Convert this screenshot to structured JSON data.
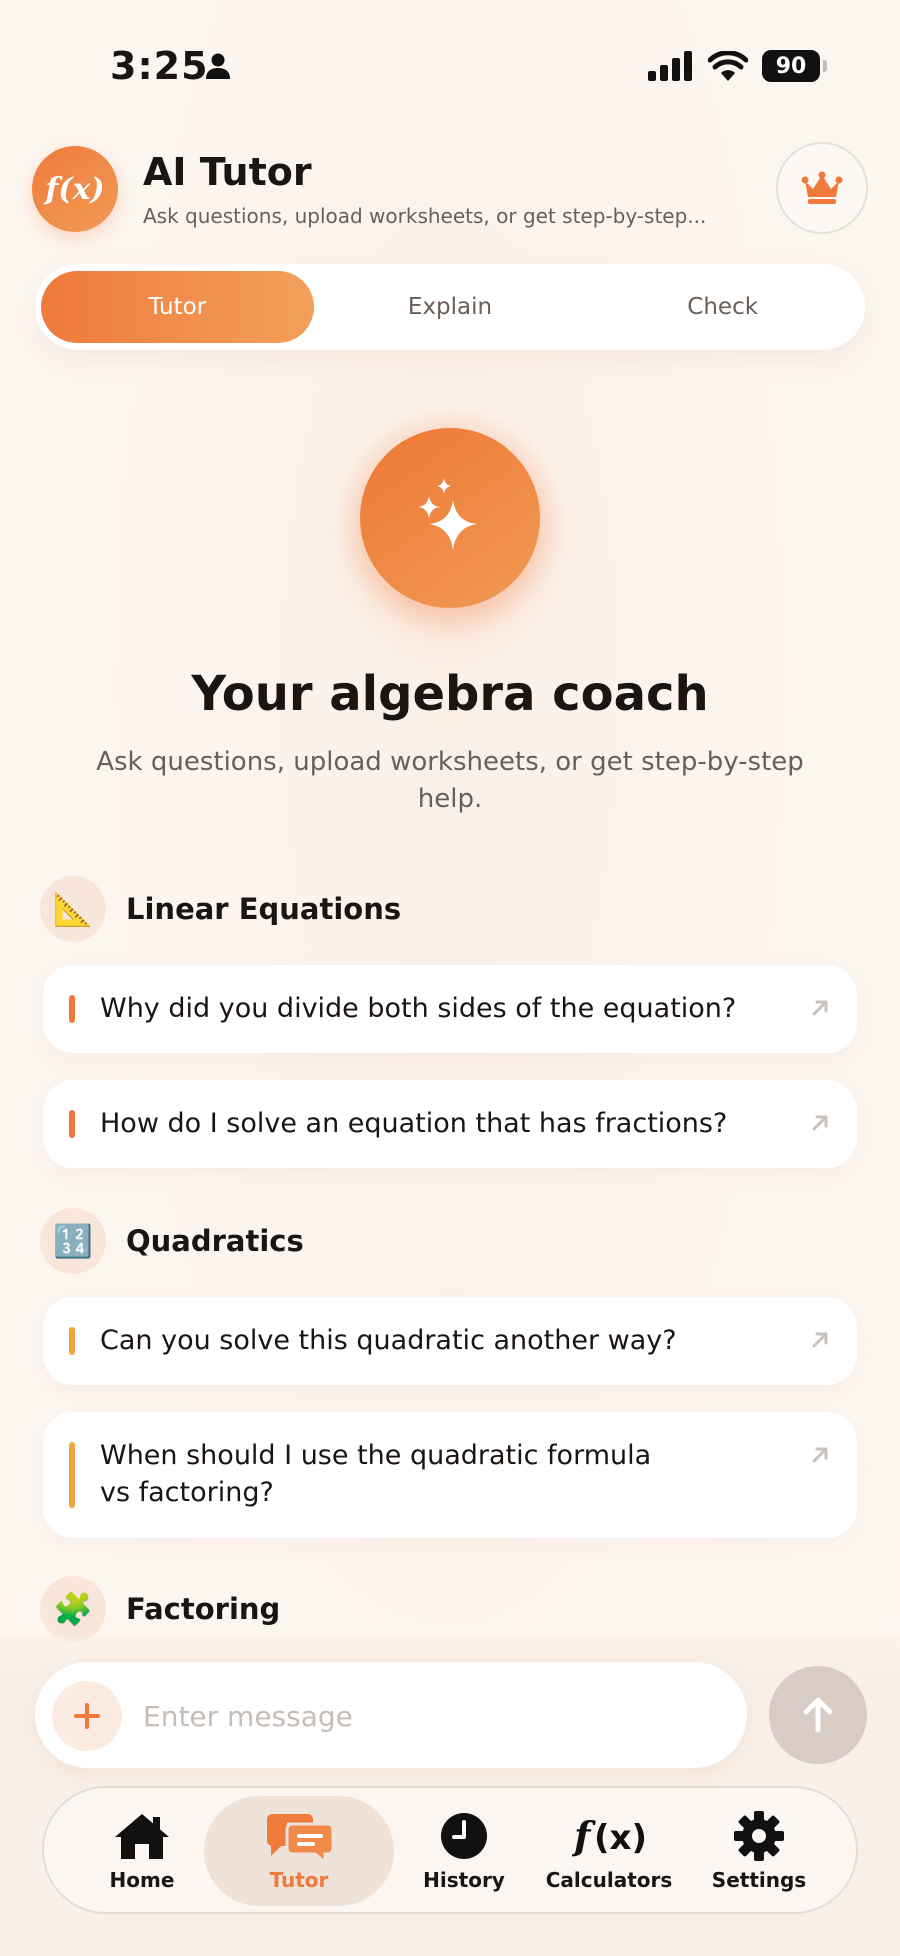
{
  "status_bar": {
    "time": "3:25",
    "battery": "90"
  },
  "header": {
    "logo_text": "f(x)",
    "title": "AI Tutor",
    "subtitle": "Ask questions, upload worksheets, or get step-by-step..."
  },
  "segments": [
    {
      "label": "Tutor",
      "active": true
    },
    {
      "label": "Explain",
      "active": false
    },
    {
      "label": "Check",
      "active": false
    }
  ],
  "hero": {
    "title": "Your algebra coach",
    "subtitle": "Ask questions, upload worksheets, or get step-by-step help."
  },
  "sections": [
    {
      "title": "Linear Equations",
      "icon": "📐",
      "accent": "#ee7a3a",
      "prompts": [
        "Why did you divide both sides of the equation?",
        "How do I solve an equation that has fractions?"
      ]
    },
    {
      "title": "Quadratics",
      "icon": "🔢",
      "accent": "#f0a640",
      "prompts": [
        "Can you solve this quadratic another way?",
        "When should I use the quadratic formula vs factoring?"
      ]
    },
    {
      "title": "Factoring",
      "icon": "🧩",
      "accent": "#6aa84f",
      "prompts": []
    }
  ],
  "composer": {
    "placeholder": "Enter message"
  },
  "tabbar": [
    {
      "label": "Home",
      "icon": "home-icon",
      "active": false
    },
    {
      "label": "Tutor",
      "icon": "chat-icon",
      "active": true
    },
    {
      "label": "History",
      "icon": "clock-icon",
      "active": false
    },
    {
      "label": "Calculators",
      "icon": "function-icon",
      "active": false
    },
    {
      "label": "Settings",
      "icon": "gear-icon",
      "active": false
    }
  ],
  "colors": {
    "accent": "#ef7a3c",
    "accent_light": "#f2a05a",
    "background": "#fcf4ee"
  }
}
